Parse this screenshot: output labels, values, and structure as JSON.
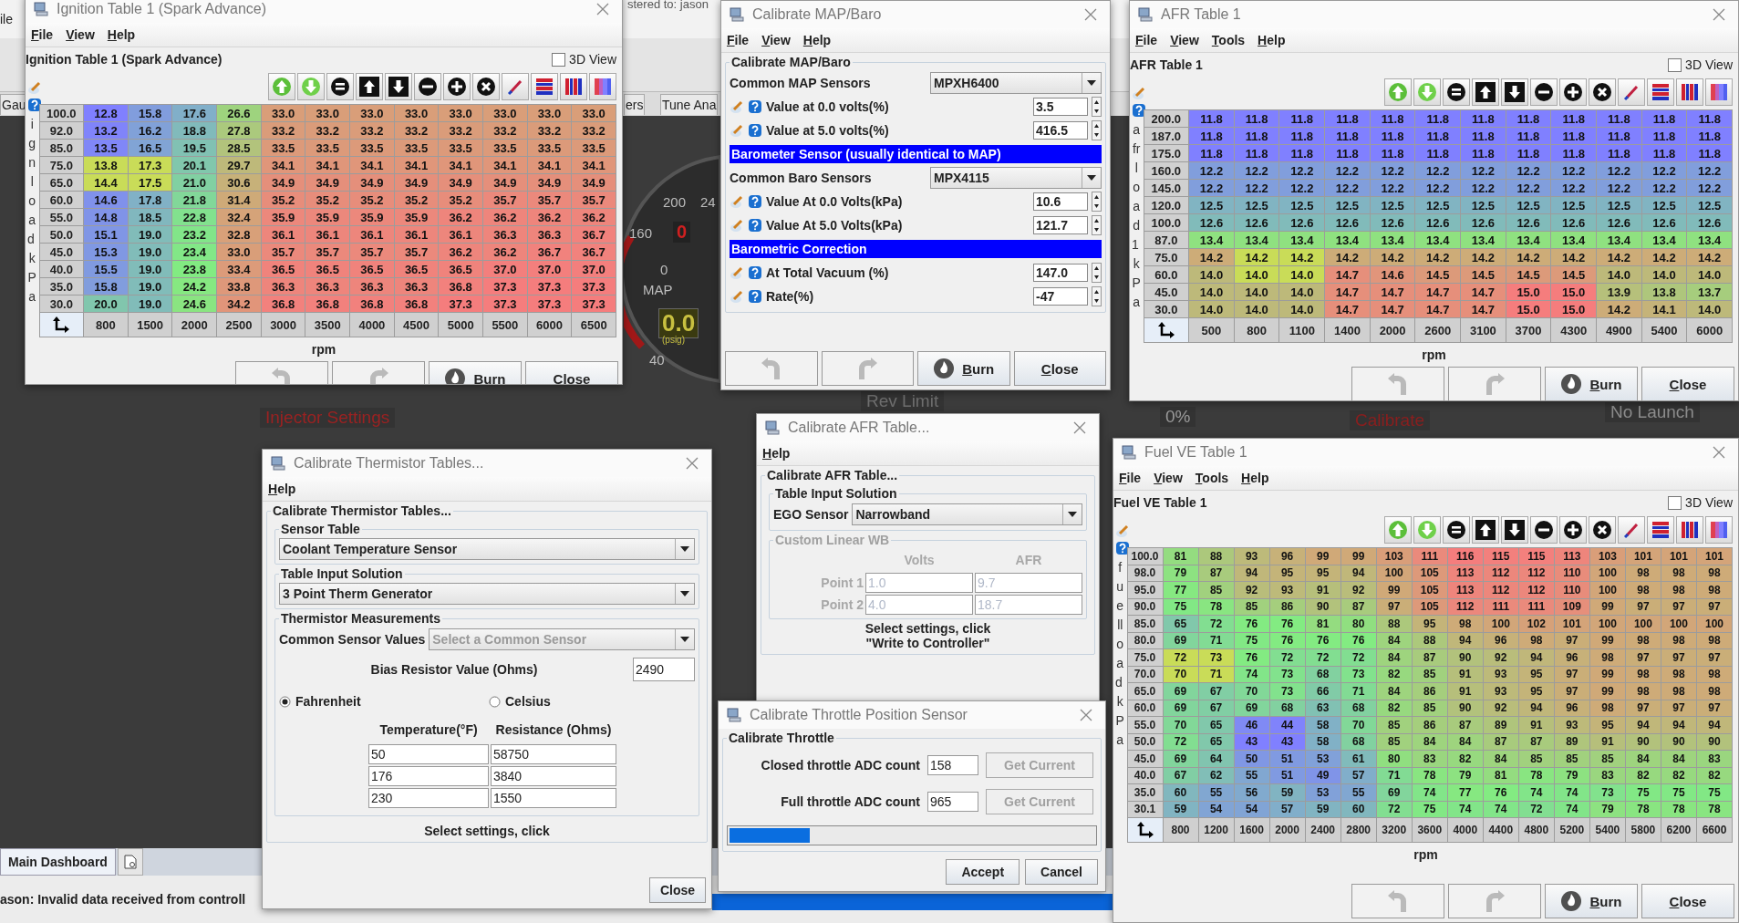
{
  "dashboard": {
    "menu": [
      "ile"
    ],
    "registration": "stered to: jason",
    "tabs": [
      {
        "label": "Gau",
        "selected": false
      },
      {
        "label": "ers",
        "selected": false
      },
      {
        "label": "Tune Ana",
        "selected": false
      }
    ],
    "gauge": {
      "labels": [
        "200",
        "24",
        "160",
        "0",
        "MAP",
        "40"
      ],
      "warning": "0",
      "reading": "0.0",
      "unit": "(psig)"
    },
    "indicators": [
      {
        "label": "Injector Settings",
        "color": "#9a2222"
      },
      {
        "label": "Rev Limit",
        "color": "#6e6e6e"
      },
      {
        "label": "0%",
        "color": "#9a9a9a"
      },
      {
        "label": "Calibrate",
        "color": "#8a1e1e"
      },
      {
        "label": "No Launch",
        "color": "#8c8c8c"
      }
    ],
    "bottom_tabs": [
      {
        "label": "Main Dashboard",
        "selected": true
      }
    ],
    "status": "ason: Invalid data received from controll"
  },
  "windows": [
    {
      "kind": "table",
      "title": "Ignition Table 1 (Spark Advance)",
      "menu": [
        "File",
        "View",
        "Help"
      ],
      "heading": "Ignition Table 1 (Spark Advance)",
      "view_3d": {
        "label": "3D View",
        "checked": false
      },
      "y_axis_label": "ignload kPa",
      "x_axis_label": "rpm",
      "rows": [
        {
          "load": "100.0",
          "cells": [
            "12.8",
            "15.8",
            "17.6",
            "26.6",
            "33.0",
            "33.0",
            "33.0",
            "33.0",
            "33.0",
            "33.0",
            "33.0",
            "33.0"
          ],
          "selected": [
            false,
            false,
            false,
            false,
            false,
            false,
            false,
            false,
            false,
            false,
            false,
            false
          ]
        },
        {
          "load": "92.0",
          "cells": [
            "13.2",
            "16.2",
            "18.8",
            "27.8",
            "33.2",
            "33.2",
            "33.2",
            "33.2",
            "33.2",
            "33.2",
            "33.2",
            "33.2"
          ],
          "selected": [
            false,
            false,
            false,
            false,
            false,
            false,
            false,
            false,
            false,
            false,
            false,
            false
          ]
        },
        {
          "load": "85.0",
          "cells": [
            "13.5",
            "16.5",
            "19.5",
            "28.5",
            "33.5",
            "33.5",
            "33.5",
            "33.5",
            "33.5",
            "33.5",
            "33.5",
            "33.5"
          ],
          "selected": [
            false,
            false,
            false,
            false,
            false,
            false,
            false,
            false,
            false,
            false,
            false,
            false
          ]
        },
        {
          "load": "75.0",
          "cells": [
            "13.8",
            "17.3",
            "20.1",
            "29.7",
            "34.1",
            "34.1",
            "34.1",
            "34.1",
            "34.1",
            "34.1",
            "34.1",
            "34.1"
          ],
          "selected": [
            true,
            true,
            false,
            false,
            false,
            false,
            false,
            false,
            false,
            false,
            false,
            false
          ]
        },
        {
          "load": "65.0",
          "cells": [
            "14.4",
            "17.5",
            "21.0",
            "30.6",
            "34.9",
            "34.9",
            "34.9",
            "34.9",
            "34.9",
            "34.9",
            "34.9",
            "34.9"
          ],
          "selected": [
            true,
            true,
            false,
            false,
            false,
            false,
            false,
            false,
            false,
            false,
            false,
            false
          ]
        },
        {
          "load": "60.0",
          "cells": [
            "14.6",
            "17.8",
            "21.8",
            "31.4",
            "35.2",
            "35.2",
            "35.2",
            "35.2",
            "35.2",
            "35.7",
            "35.7",
            "35.7"
          ],
          "selected": [
            false,
            false,
            false,
            false,
            false,
            false,
            false,
            false,
            false,
            false,
            false,
            false
          ]
        },
        {
          "load": "55.0",
          "cells": [
            "14.8",
            "18.5",
            "22.8",
            "32.4",
            "35.9",
            "35.9",
            "35.9",
            "35.9",
            "36.2",
            "36.2",
            "36.2",
            "36.2"
          ],
          "selected": [
            false,
            false,
            false,
            false,
            false,
            false,
            false,
            false,
            false,
            false,
            false,
            false
          ]
        },
        {
          "load": "50.0",
          "cells": [
            "15.1",
            "19.0",
            "23.2",
            "32.8",
            "36.1",
            "36.1",
            "36.1",
            "36.1",
            "36.1",
            "36.3",
            "36.3",
            "36.7"
          ],
          "selected": [
            false,
            false,
            false,
            false,
            false,
            false,
            false,
            false,
            false,
            false,
            false,
            false
          ]
        },
        {
          "load": "45.0",
          "cells": [
            "15.3",
            "19.0",
            "23.4",
            "33.0",
            "35.7",
            "35.7",
            "35.7",
            "35.7",
            "36.2",
            "36.2",
            "36.7",
            "36.7"
          ],
          "selected": [
            false,
            false,
            false,
            false,
            false,
            false,
            false,
            false,
            false,
            false,
            false,
            false
          ]
        },
        {
          "load": "40.0",
          "cells": [
            "15.5",
            "19.0",
            "23.8",
            "33.4",
            "36.5",
            "36.5",
            "36.5",
            "36.5",
            "36.5",
            "37.0",
            "37.0",
            "37.0"
          ],
          "selected": [
            false,
            false,
            false,
            false,
            false,
            false,
            false,
            false,
            false,
            false,
            false,
            false
          ]
        },
        {
          "load": "35.0",
          "cells": [
            "15.8",
            "19.0",
            "24.2",
            "33.8",
            "36.3",
            "36.3",
            "36.3",
            "36.3",
            "36.8",
            "37.3",
            "37.3",
            "37.3"
          ],
          "selected": [
            false,
            false,
            false,
            false,
            false,
            false,
            false,
            false,
            false,
            false,
            false,
            false
          ]
        },
        {
          "load": "30.0",
          "cells": [
            "20.0",
            "19.0",
            "24.6",
            "34.2",
            "36.8",
            "36.8",
            "36.8",
            "36.8",
            "37.3",
            "37.3",
            "37.3",
            "37.3"
          ],
          "selected": [
            false,
            false,
            false,
            false,
            false,
            false,
            false,
            false,
            false,
            false,
            false,
            false
          ]
        }
      ],
      "x_axis_values": [
        "800",
        "1500",
        "2000",
        "2500",
        "3000",
        "3500",
        "4000",
        "4500",
        "5000",
        "5500",
        "6000",
        "6500"
      ],
      "buttons": [
        {
          "kind": "undo",
          "disabled": true
        },
        {
          "kind": "redo",
          "disabled": true
        },
        {
          "kind": "burn",
          "label": "Burn"
        },
        {
          "kind": "close",
          "label": "Close"
        }
      ]
    },
    {
      "kind": "map_baro",
      "title": "Calibrate MAP/Baro",
      "menu": [
        "File",
        "View",
        "Help"
      ],
      "panel_title": "Calibrate MAP/Baro",
      "rows": [
        {
          "kind": "combo",
          "label": "Common MAP Sensors",
          "value": "MPXH6400"
        },
        {
          "kind": "spinner",
          "label": "Value at 0.0 volts(%)",
          "value": "3.5"
        },
        {
          "kind": "spinner",
          "label": "Value at 5.0 volts(%)",
          "value": "416.5"
        },
        {
          "kind": "banner",
          "label": "Barometer Sensor (usually identical to MAP)"
        },
        {
          "kind": "combo",
          "label": "Common Baro Sensors",
          "value": "MPX4115"
        },
        {
          "kind": "spinner",
          "label": "Value At 0.0 Volts(kPa)",
          "value": "10.6"
        },
        {
          "kind": "spinner",
          "label": "Value At 5.0 Volts(kPa)",
          "value": "121.7"
        },
        {
          "kind": "banner",
          "label": "Barometric Correction"
        },
        {
          "kind": "spinner",
          "label": "At Total Vacuum (%)",
          "value": "147.0"
        },
        {
          "kind": "spinner",
          "label": "Rate(%)",
          "value": "-47"
        }
      ],
      "buttons": [
        {
          "kind": "undo",
          "disabled": true
        },
        {
          "kind": "redo",
          "disabled": true
        },
        {
          "kind": "burn",
          "label": "Burn"
        },
        {
          "kind": "close",
          "label": "Close"
        }
      ]
    },
    {
      "kind": "table",
      "title": "AFR Table 1",
      "menu": [
        "File",
        "View",
        "Tools",
        "Help"
      ],
      "heading": "AFR Table 1",
      "view_3d": {
        "label": "3D View",
        "checked": false
      },
      "y_axis_label": "afrload1 kPa",
      "x_axis_label": "rpm",
      "rows": [
        {
          "load": "200.0",
          "cells": [
            "11.8",
            "11.8",
            "11.8",
            "11.8",
            "11.8",
            "11.8",
            "11.8",
            "11.8",
            "11.8",
            "11.8",
            "11.8",
            "11.8"
          ],
          "selected": [
            false,
            false,
            false,
            false,
            false,
            false,
            false,
            false,
            false,
            false,
            false,
            false
          ]
        },
        {
          "load": "187.0",
          "cells": [
            "11.8",
            "11.8",
            "11.8",
            "11.8",
            "11.8",
            "11.8",
            "11.8",
            "11.8",
            "11.8",
            "11.8",
            "11.8",
            "11.8"
          ],
          "selected": [
            false,
            false,
            false,
            false,
            false,
            false,
            false,
            false,
            false,
            false,
            false,
            false
          ]
        },
        {
          "load": "175.0",
          "cells": [
            "11.8",
            "11.8",
            "11.8",
            "11.8",
            "11.8",
            "11.8",
            "11.8",
            "11.8",
            "11.8",
            "11.8",
            "11.8",
            "11.8"
          ],
          "selected": [
            false,
            false,
            false,
            false,
            false,
            false,
            false,
            false,
            false,
            false,
            false,
            false
          ]
        },
        {
          "load": "160.0",
          "cells": [
            "12.2",
            "12.2",
            "12.2",
            "12.2",
            "12.2",
            "12.2",
            "12.2",
            "12.2",
            "12.2",
            "12.2",
            "12.2",
            "12.2"
          ],
          "selected": [
            false,
            false,
            false,
            false,
            false,
            false,
            false,
            false,
            false,
            false,
            false,
            false
          ]
        },
        {
          "load": "145.0",
          "cells": [
            "12.2",
            "12.2",
            "12.2",
            "12.2",
            "12.2",
            "12.2",
            "12.2",
            "12.2",
            "12.2",
            "12.2",
            "12.2",
            "12.2"
          ],
          "selected": [
            false,
            false,
            false,
            false,
            false,
            false,
            false,
            false,
            false,
            false,
            false,
            false
          ]
        },
        {
          "load": "120.0",
          "cells": [
            "12.5",
            "12.5",
            "12.5",
            "12.5",
            "12.5",
            "12.5",
            "12.5",
            "12.5",
            "12.5",
            "12.5",
            "12.5",
            "12.5"
          ],
          "selected": [
            false,
            false,
            false,
            false,
            false,
            false,
            false,
            false,
            false,
            false,
            false,
            false
          ]
        },
        {
          "load": "100.0",
          "cells": [
            "12.6",
            "12.6",
            "12.6",
            "12.6",
            "12.6",
            "12.6",
            "12.6",
            "12.6",
            "12.6",
            "12.6",
            "12.6",
            "12.6"
          ],
          "selected": [
            false,
            false,
            false,
            false,
            false,
            false,
            false,
            false,
            false,
            false,
            false,
            false
          ]
        },
        {
          "load": "87.0",
          "cells": [
            "13.4",
            "13.4",
            "13.4",
            "13.4",
            "13.4",
            "13.4",
            "13.4",
            "13.4",
            "13.4",
            "13.4",
            "13.4",
            "13.4"
          ],
          "selected": [
            false,
            false,
            false,
            false,
            false,
            false,
            false,
            false,
            false,
            false,
            false,
            false
          ]
        },
        {
          "load": "75.0",
          "cells": [
            "14.2",
            "14.2",
            "14.2",
            "14.2",
            "14.2",
            "14.2",
            "14.2",
            "14.2",
            "14.2",
            "14.2",
            "14.2",
            "14.2"
          ],
          "selected": [
            false,
            true,
            true,
            false,
            false,
            false,
            false,
            false,
            false,
            false,
            false,
            false
          ]
        },
        {
          "load": "60.0",
          "cells": [
            "14.0",
            "14.0",
            "14.0",
            "14.7",
            "14.6",
            "14.5",
            "14.5",
            "14.5",
            "14.5",
            "14.0",
            "14.0",
            "14.0"
          ],
          "selected": [
            false,
            true,
            true,
            false,
            false,
            false,
            false,
            false,
            false,
            false,
            false,
            false
          ]
        },
        {
          "load": "45.0",
          "cells": [
            "14.0",
            "14.0",
            "14.0",
            "14.7",
            "14.7",
            "14.7",
            "14.7",
            "15.0",
            "15.0",
            "13.9",
            "13.8",
            "13.7"
          ],
          "selected": [
            false,
            false,
            false,
            false,
            false,
            false,
            false,
            false,
            false,
            false,
            false,
            false
          ]
        },
        {
          "load": "30.0",
          "cells": [
            "14.0",
            "14.0",
            "14.0",
            "14.7",
            "14.7",
            "14.7",
            "14.7",
            "15.0",
            "15.0",
            "14.2",
            "14.1",
            "14.0"
          ],
          "selected": [
            false,
            false,
            false,
            false,
            false,
            false,
            false,
            false,
            false,
            false,
            false,
            false
          ]
        }
      ],
      "x_axis_values": [
        "500",
        "800",
        "1100",
        "1400",
        "2000",
        "2600",
        "3100",
        "3700",
        "4300",
        "4900",
        "5400",
        "6000"
      ],
      "buttons": [
        {
          "kind": "undo",
          "disabled": true
        },
        {
          "kind": "redo",
          "disabled": true
        },
        {
          "kind": "burn",
          "label": "Burn"
        },
        {
          "kind": "close",
          "label": "Close"
        }
      ]
    },
    {
      "kind": "thermistor",
      "title": "Calibrate Thermistor Tables...",
      "menu": [
        "Help"
      ],
      "panel_title": "Calibrate Thermistor Tables...",
      "sensor_table": {
        "title": "Sensor Table",
        "value": "Coolant Temperature Sensor"
      },
      "input_solution": {
        "title": "Table Input Solution",
        "value": "3 Point Therm Generator"
      },
      "measurements": {
        "title": "Thermistor Measurements",
        "common_label": "Common Sensor Values",
        "placeholder": "Select a Common Sensor",
        "bias_label": "Bias Resistor Value (Ohms)",
        "bias_value": "2490",
        "units": [
          {
            "label": "Fahrenheit",
            "selected": true
          },
          {
            "label": "Celsius",
            "selected": false
          }
        ],
        "columns": [
          "Temperature(°F)",
          "Resistance (Ohms)"
        ],
        "points": [
          {
            "temperature": "50",
            "resistance": "58750"
          },
          {
            "temperature": "176",
            "resistance": "3840"
          },
          {
            "temperature": "230",
            "resistance": "1550"
          }
        ]
      },
      "note": "Select settings, click",
      "buttons": [
        {
          "kind": "close",
          "label": "Close"
        }
      ]
    },
    {
      "kind": "afr_calibration",
      "title": "Calibrate AFR Table...",
      "menu": [
        "Help"
      ],
      "panel_title": "Calibrate AFR Table...",
      "input_solution": {
        "title": "Table Input Solution",
        "label": "EGO Sensor",
        "value": "Narrowband"
      },
      "custom": {
        "title": "Custom Linear WB",
        "disabled": true,
        "columns": [
          "Volts",
          "AFR"
        ],
        "points": [
          {
            "label": "Point 1",
            "volts": "1.0",
            "afr": "9.7"
          },
          {
            "label": "Point 2",
            "volts": "4.0",
            "afr": "18.7"
          }
        ]
      },
      "note": [
        "Select settings, click",
        "\"Write to Controller\""
      ]
    },
    {
      "kind": "throttle",
      "title": "Calibrate Throttle Position Sensor",
      "panel_title": "Calibrate Throttle",
      "rows": [
        {
          "label": "Closed throttle ADC count",
          "value": "158",
          "button": "Get Current",
          "button_disabled": true
        },
        {
          "label": "Full throttle ADC count",
          "value": "965",
          "button": "Get Current",
          "button_disabled": true
        }
      ],
      "progress": {
        "level": 0.22
      },
      "buttons": [
        {
          "kind": "accept",
          "label": "Accept"
        },
        {
          "kind": "cancel",
          "label": "Cancel"
        }
      ]
    },
    {
      "kind": "table",
      "title": "Fuel VE Table 1",
      "menu": [
        "File",
        "View",
        "Tools",
        "Help"
      ],
      "heading": "Fuel VE Table 1",
      "view_3d": {
        "label": "3D View",
        "checked": false
      },
      "y_axis_label": "fuelload kPa",
      "x_axis_label": "rpm",
      "rows": [
        {
          "load": "100.0",
          "cells": [
            "81",
            "88",
            "93",
            "96",
            "99",
            "99",
            "103",
            "111",
            "116",
            "115",
            "115",
            "113",
            "103",
            "101",
            "101",
            "101"
          ],
          "selected": [
            false,
            false,
            false,
            false,
            false,
            false,
            false,
            false,
            false,
            false,
            false,
            false,
            false,
            false,
            false,
            false
          ]
        },
        {
          "load": "98.0",
          "cells": [
            "79",
            "87",
            "94",
            "95",
            "95",
            "94",
            "100",
            "105",
            "113",
            "112",
            "112",
            "110",
            "100",
            "98",
            "98",
            "98"
          ],
          "selected": [
            false,
            false,
            false,
            false,
            false,
            false,
            false,
            false,
            false,
            false,
            false,
            false,
            false,
            false,
            false,
            false
          ]
        },
        {
          "load": "95.0",
          "cells": [
            "77",
            "85",
            "92",
            "93",
            "91",
            "92",
            "99",
            "105",
            "113",
            "112",
            "112",
            "110",
            "100",
            "98",
            "98",
            "98"
          ],
          "selected": [
            false,
            false,
            false,
            false,
            false,
            false,
            false,
            false,
            false,
            false,
            false,
            false,
            false,
            false,
            false,
            false
          ]
        },
        {
          "load": "90.0",
          "cells": [
            "75",
            "78",
            "85",
            "86",
            "90",
            "87",
            "97",
            "105",
            "112",
            "111",
            "111",
            "109",
            "99",
            "97",
            "97",
            "97"
          ],
          "selected": [
            false,
            false,
            false,
            false,
            false,
            false,
            false,
            false,
            false,
            false,
            false,
            false,
            false,
            false,
            false,
            false
          ]
        },
        {
          "load": "85.0",
          "cells": [
            "65",
            "72",
            "76",
            "76",
            "81",
            "80",
            "88",
            "95",
            "98",
            "100",
            "102",
            "101",
            "100",
            "100",
            "100",
            "100"
          ],
          "selected": [
            false,
            false,
            false,
            false,
            false,
            false,
            false,
            false,
            false,
            false,
            false,
            false,
            false,
            false,
            false,
            false
          ]
        },
        {
          "load": "80.0",
          "cells": [
            "69",
            "71",
            "75",
            "76",
            "76",
            "76",
            "84",
            "88",
            "94",
            "96",
            "98",
            "97",
            "99",
            "98",
            "98",
            "98"
          ],
          "selected": [
            false,
            false,
            false,
            false,
            false,
            false,
            false,
            false,
            false,
            false,
            false,
            false,
            false,
            false,
            false,
            false
          ]
        },
        {
          "load": "75.0",
          "cells": [
            "72",
            "73",
            "76",
            "72",
            "72",
            "72",
            "84",
            "87",
            "90",
            "92",
            "94",
            "96",
            "98",
            "97",
            "97",
            "97"
          ],
          "selected": [
            true,
            true,
            false,
            false,
            false,
            false,
            false,
            false,
            false,
            false,
            false,
            false,
            false,
            false,
            false,
            false
          ]
        },
        {
          "load": "70.0",
          "cells": [
            "70",
            "71",
            "74",
            "73",
            "68",
            "73",
            "82",
            "85",
            "91",
            "93",
            "95",
            "97",
            "99",
            "98",
            "98",
            "98"
          ],
          "selected": [
            true,
            true,
            false,
            false,
            false,
            false,
            false,
            false,
            false,
            false,
            false,
            false,
            false,
            false,
            false,
            false
          ]
        },
        {
          "load": "65.0",
          "cells": [
            "69",
            "67",
            "70",
            "73",
            "66",
            "71",
            "84",
            "86",
            "91",
            "93",
            "95",
            "97",
            "99",
            "98",
            "98",
            "98"
          ],
          "selected": [
            false,
            false,
            false,
            false,
            false,
            false,
            false,
            false,
            false,
            false,
            false,
            false,
            false,
            false,
            false,
            false
          ]
        },
        {
          "load": "60.0",
          "cells": [
            "69",
            "67",
            "69",
            "68",
            "63",
            "68",
            "82",
            "85",
            "90",
            "92",
            "94",
            "96",
            "98",
            "97",
            "97",
            "97"
          ],
          "selected": [
            false,
            false,
            false,
            false,
            false,
            false,
            false,
            false,
            false,
            false,
            false,
            false,
            false,
            false,
            false,
            false
          ]
        },
        {
          "load": "55.0",
          "cells": [
            "70",
            "65",
            "46",
            "44",
            "58",
            "70",
            "85",
            "86",
            "87",
            "89",
            "91",
            "93",
            "95",
            "94",
            "94",
            "94"
          ],
          "selected": [
            false,
            false,
            false,
            false,
            false,
            false,
            false,
            false,
            false,
            false,
            false,
            false,
            false,
            false,
            false,
            false
          ]
        },
        {
          "load": "50.0",
          "cells": [
            "72",
            "65",
            "43",
            "43",
            "58",
            "68",
            "85",
            "84",
            "84",
            "87",
            "87",
            "89",
            "91",
            "90",
            "90",
            "90"
          ],
          "selected": [
            false,
            false,
            false,
            false,
            false,
            false,
            false,
            false,
            false,
            false,
            false,
            false,
            false,
            false,
            false,
            false
          ]
        },
        {
          "load": "45.0",
          "cells": [
            "69",
            "64",
            "50",
            "51",
            "53",
            "61",
            "80",
            "83",
            "82",
            "84",
            "85",
            "85",
            "85",
            "84",
            "84",
            "83"
          ],
          "selected": [
            false,
            false,
            false,
            false,
            false,
            false,
            false,
            false,
            false,
            false,
            false,
            false,
            false,
            false,
            false,
            false
          ]
        },
        {
          "load": "40.0",
          "cells": [
            "67",
            "62",
            "55",
            "51",
            "49",
            "57",
            "71",
            "78",
            "79",
            "81",
            "78",
            "79",
            "83",
            "82",
            "82",
            "82"
          ],
          "selected": [
            false,
            false,
            false,
            false,
            false,
            false,
            false,
            false,
            false,
            false,
            false,
            false,
            false,
            false,
            false,
            false
          ]
        },
        {
          "load": "35.0",
          "cells": [
            "60",
            "55",
            "56",
            "59",
            "53",
            "55",
            "69",
            "74",
            "77",
            "76",
            "74",
            "74",
            "73",
            "75",
            "75",
            "75"
          ],
          "selected": [
            false,
            false,
            false,
            false,
            false,
            false,
            false,
            false,
            false,
            false,
            false,
            false,
            false,
            false,
            false,
            false
          ]
        },
        {
          "load": "30.1",
          "cells": [
            "59",
            "54",
            "54",
            "57",
            "59",
            "60",
            "72",
            "75",
            "74",
            "74",
            "72",
            "74",
            "79",
            "78",
            "78",
            "78"
          ],
          "selected": [
            false,
            false,
            false,
            false,
            false,
            false,
            false,
            false,
            false,
            false,
            false,
            false,
            false,
            false,
            false,
            false
          ]
        }
      ],
      "x_axis_values": [
        "800",
        "1200",
        "1600",
        "2000",
        "2400",
        "2800",
        "3200",
        "3600",
        "4000",
        "4400",
        "4800",
        "5200",
        "5400",
        "5800",
        "6200",
        "6600"
      ],
      "buttons": [
        {
          "kind": "undo",
          "disabled": true
        },
        {
          "kind": "redo",
          "disabled": true
        },
        {
          "kind": "burn",
          "label": "Burn"
        },
        {
          "kind": "close",
          "label": "Close"
        }
      ]
    }
  ]
}
